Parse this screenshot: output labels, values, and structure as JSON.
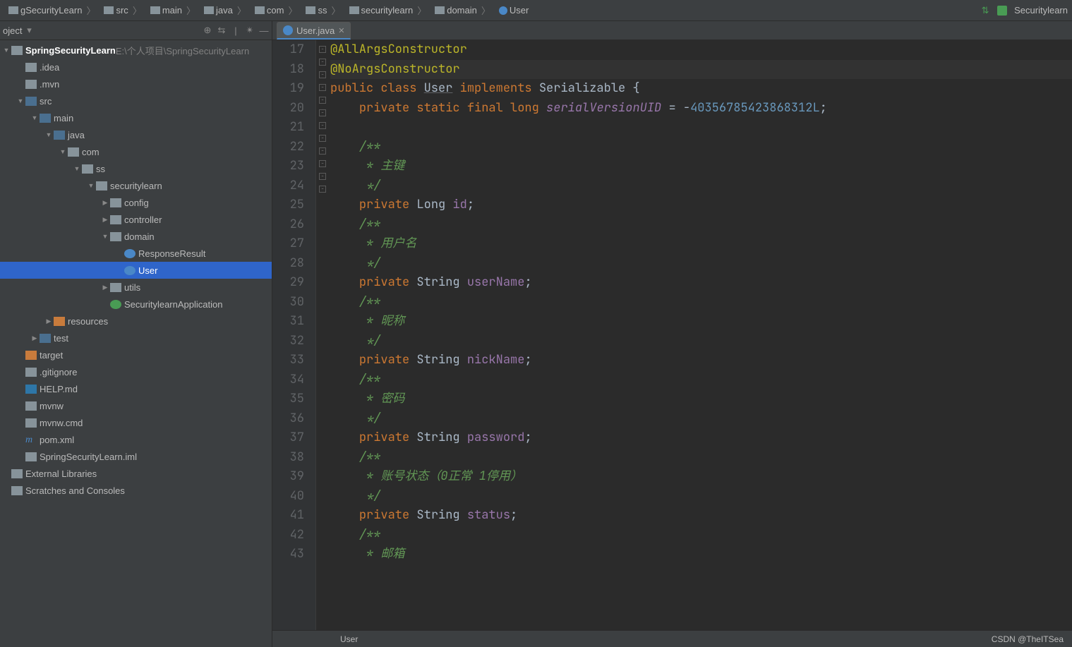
{
  "breadcrumb": [
    {
      "icon": "folder",
      "label": "gSecurityLearn"
    },
    {
      "icon": "folder",
      "label": "src"
    },
    {
      "icon": "folder",
      "label": "main"
    },
    {
      "icon": "folder",
      "label": "java"
    },
    {
      "icon": "folder",
      "label": "com"
    },
    {
      "icon": "folder",
      "label": "ss"
    },
    {
      "icon": "folder",
      "label": "securitylearn"
    },
    {
      "icon": "folder",
      "label": "domain"
    },
    {
      "icon": "class",
      "label": "User"
    }
  ],
  "topright": {
    "labelA": "",
    "labelB": "Securitylearn"
  },
  "sidebar_header": {
    "title": "oject",
    "dropdown": ""
  },
  "project": {
    "root": {
      "name": "SpringSecurityLearn",
      "path": "E:\\个人项目\\SpringSecurityLearn"
    },
    "nodes": [
      {
        "indent": 1,
        "twisty": "",
        "icon": "folder",
        "label": ".idea"
      },
      {
        "indent": 1,
        "twisty": "",
        "icon": "folder",
        "label": ".mvn"
      },
      {
        "indent": 1,
        "twisty": "▼",
        "icon": "folder blue",
        "label": "src"
      },
      {
        "indent": 2,
        "twisty": "▼",
        "icon": "folder blue",
        "label": "main"
      },
      {
        "indent": 3,
        "twisty": "▼",
        "icon": "folder blue",
        "label": "java"
      },
      {
        "indent": 4,
        "twisty": "▼",
        "icon": "folder",
        "label": "com"
      },
      {
        "indent": 5,
        "twisty": "▼",
        "icon": "folder",
        "label": "ss"
      },
      {
        "indent": 6,
        "twisty": "▼",
        "icon": "folder",
        "label": "securitylearn"
      },
      {
        "indent": 7,
        "twisty": "▶",
        "icon": "folder",
        "label": "config"
      },
      {
        "indent": 7,
        "twisty": "▶",
        "icon": "folder",
        "label": "controller"
      },
      {
        "indent": 7,
        "twisty": "▼",
        "icon": "folder",
        "label": "domain"
      },
      {
        "indent": 8,
        "twisty": "",
        "icon": "class",
        "label": "ResponseResult"
      },
      {
        "indent": 8,
        "twisty": "",
        "icon": "class",
        "label": "User",
        "selected": true
      },
      {
        "indent": 7,
        "twisty": "▶",
        "icon": "folder",
        "label": "utils"
      },
      {
        "indent": 7,
        "twisty": "",
        "icon": "spring",
        "label": "SecuritylearnApplication"
      },
      {
        "indent": 3,
        "twisty": "▶",
        "icon": "folder lib-icon",
        "label": "resources"
      },
      {
        "indent": 2,
        "twisty": "▶",
        "icon": "folder blue",
        "label": "test"
      },
      {
        "indent": 1,
        "twisty": "",
        "icon": "folder orange",
        "label": "target"
      },
      {
        "indent": 1,
        "twisty": "",
        "icon": "txt",
        "label": ".gitignore"
      },
      {
        "indent": 1,
        "twisty": "",
        "icon": "md",
        "label": "HELP.md"
      },
      {
        "indent": 1,
        "twisty": "",
        "icon": "txt",
        "label": "mvnw"
      },
      {
        "indent": 1,
        "twisty": "",
        "icon": "txt",
        "label": "mvnw.cmd"
      },
      {
        "indent": 1,
        "twisty": "",
        "icon": "pom",
        "label": "pom.xml"
      },
      {
        "indent": 1,
        "twisty": "",
        "icon": "txt",
        "label": "SpringSecurityLearn.iml"
      },
      {
        "indent": 0,
        "twisty": "",
        "icon": "lib2",
        "label": "External Libraries"
      },
      {
        "indent": 0,
        "twisty": "",
        "icon": "lib2",
        "label": "Scratches and Consoles"
      }
    ]
  },
  "tab": {
    "icon": "class",
    "label": "User.java"
  },
  "gutter_start": 17,
  "code_lines": [
    {
      "n": 17,
      "html": "<span class='ann'>@AllArgsConstructor</span>"
    },
    {
      "n": 18,
      "html": "<span class='ann'>@NoArgsConstructor</span>",
      "hl": true
    },
    {
      "n": 19,
      "html": "<span class='k'>public</span> <span class='k'>class</span> <span class='ul'>User</span> <span class='k'>implements</span> Serializable {"
    },
    {
      "n": 20,
      "html": "    <span class='k'>private</span> <span class='k'>static</span> <span class='k'>final</span> <span class='k'>long</span> <span class='fld' style='font-style:italic'>serialVersionUID</span> = -<span class='num'>40356785423868312L</span>;"
    },
    {
      "n": 21,
      "html": ""
    },
    {
      "n": 22,
      "html": "    <span class='com'>/**</span>"
    },
    {
      "n": 23,
      "html": "<span class='com'>     * 主键</span>"
    },
    {
      "n": 24,
      "html": "<span class='com'>     */</span>"
    },
    {
      "n": 25,
      "html": "    <span class='k'>private</span> Long <span class='fld'>id</span>;"
    },
    {
      "n": 26,
      "html": "    <span class='com'>/**</span>"
    },
    {
      "n": 27,
      "html": "<span class='com'>     * 用户名</span>"
    },
    {
      "n": 28,
      "html": "<span class='com'>     */</span>"
    },
    {
      "n": 29,
      "html": "    <span class='k'>private</span> String <span class='fld'>userName</span>;"
    },
    {
      "n": 30,
      "html": "    <span class='com'>/**</span>"
    },
    {
      "n": 31,
      "html": "<span class='com'>     * 昵称</span>"
    },
    {
      "n": 32,
      "html": "<span class='com'>     */</span>"
    },
    {
      "n": 33,
      "html": "    <span class='k'>private</span> String <span class='fld'>nickName</span>;"
    },
    {
      "n": 34,
      "html": "    <span class='com'>/**</span>"
    },
    {
      "n": 35,
      "html": "<span class='com'>     * 密码</span>"
    },
    {
      "n": 36,
      "html": "<span class='com'>     */</span>"
    },
    {
      "n": 37,
      "html": "    <span class='k'>private</span> String <span class='fld'>password</span>;"
    },
    {
      "n": 38,
      "html": "    <span class='com'>/**</span>"
    },
    {
      "n": 39,
      "html": "<span class='com'>     * 账号状态（0正常 1停用）</span>"
    },
    {
      "n": 40,
      "html": "<span class='com'>     */</span>"
    },
    {
      "n": 41,
      "html": "    <span class='k'>private</span> String <span class='fld'>status</span>;"
    },
    {
      "n": 42,
      "html": "    <span class='com'>/**</span>"
    },
    {
      "n": 43,
      "html": "<span class='com'>     * 邮箱</span>"
    }
  ],
  "status": {
    "left": "User",
    "right": "CSDN @TheITSea"
  }
}
